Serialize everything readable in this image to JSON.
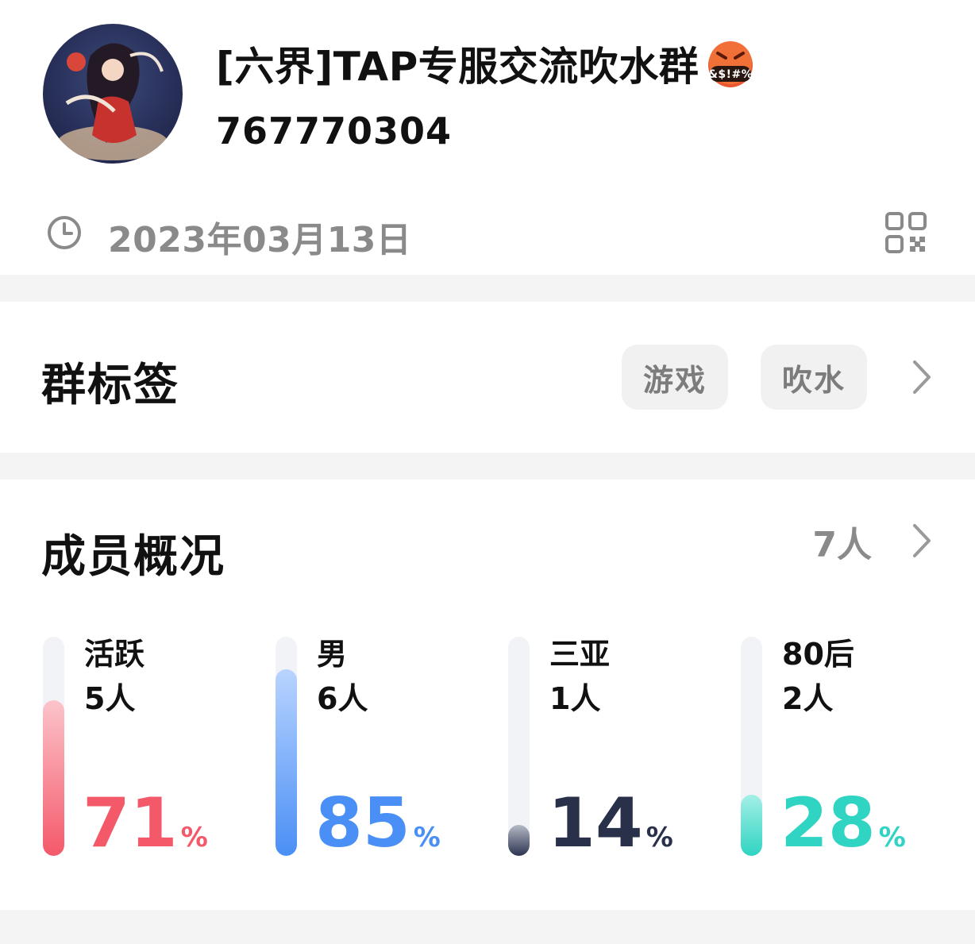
{
  "header": {
    "group_name": "[六界]TAP专服交流吹水群",
    "group_id": "767770304",
    "created_date": "2023年03月13日",
    "emoji_text": "&$!#%"
  },
  "tags_section": {
    "title": "群标签",
    "tags": [
      "游戏",
      "吹水"
    ]
  },
  "members_section": {
    "title": "成员概况",
    "total": "7人",
    "stats": [
      {
        "label": "活跃",
        "count": "5人",
        "percent": "71",
        "unit": "%",
        "fraction": 0.71,
        "color": "#f4596a",
        "fill_top": "#fcc4cb",
        "fill_bottom": "#f4596a"
      },
      {
        "label": "男",
        "count": "6人",
        "percent": "85",
        "unit": "%",
        "fraction": 0.85,
        "color": "#4a8ff5",
        "fill_top": "#b9d4ff",
        "fill_bottom": "#4a8ff5"
      },
      {
        "label": "三亚",
        "count": "1人",
        "percent": "14",
        "unit": "%",
        "fraction": 0.14,
        "color": "#28304a",
        "fill_top": "#b6bac6",
        "fill_bottom": "#2b3350"
      },
      {
        "label": "80后",
        "count": "2人",
        "percent": "28",
        "unit": "%",
        "fraction": 0.28,
        "color": "#2fd4c2",
        "fill_top": "#a4efe6",
        "fill_bottom": "#2fd4c2"
      }
    ]
  },
  "icons": {
    "clock": "clock-icon",
    "qr": "qr-code-icon",
    "chevron": "chevron-right-icon"
  }
}
